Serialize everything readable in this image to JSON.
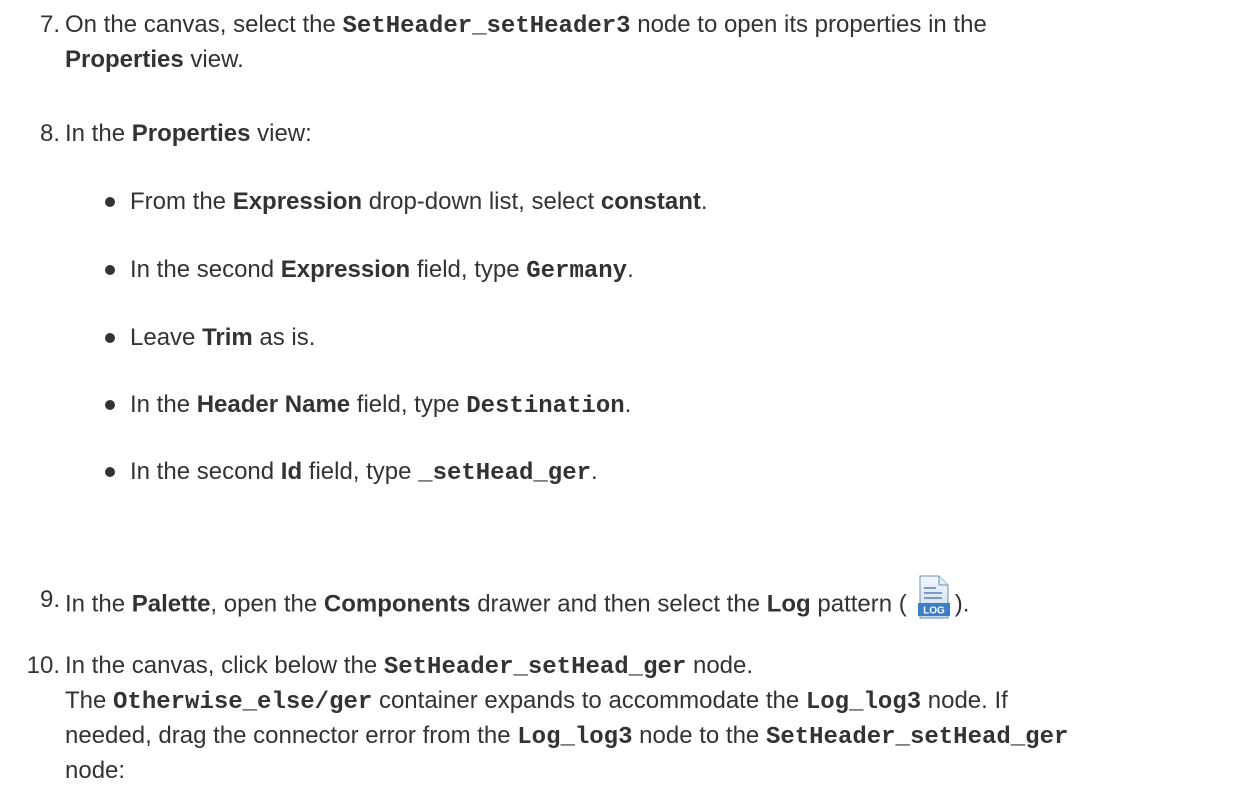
{
  "steps": [
    {
      "number": "7.",
      "t1": "On the canvas, select the ",
      "c1": "SetHeader_setHeader3",
      "t2": " node to open its properties in the ",
      "b1": "Properties",
      "t3": " view."
    },
    {
      "number": "8.",
      "t1": "In the ",
      "b1": "Properties",
      "t2": " view:"
    },
    {
      "number": "9.",
      "t1": "In the ",
      "b1": "Palette",
      "t2": ", open the ",
      "b2": "Components",
      "t3": " drawer and then select the ",
      "b3": "Log",
      "t4": " pattern (",
      "t5": ")."
    },
    {
      "number": "10.",
      "t1": "In the canvas, click below the ",
      "c1": "SetHeader_setHead_ger",
      "t2": " node.",
      "t3": "The ",
      "c2": "Otherwise_else/ger",
      "t4": " container expands to accommodate the ",
      "c3": "Log_log3",
      "t5": " node. If",
      "t6": "needed, drag the connector error from the ",
      "c4": "Log_log3",
      "t7": " node to the ",
      "c5": "SetHeader_setHead_ger",
      "t8": "node:"
    }
  ],
  "bullets": [
    {
      "t1": "From the ",
      "b1": "Expression",
      "t2": " drop-down list, select ",
      "b2": "constant",
      "t3": "."
    },
    {
      "t1": "In the second ",
      "b1": "Expression",
      "t2": " field, type ",
      "c1": "Germany",
      "t3": "."
    },
    {
      "t1": "Leave ",
      "b1": "Trim",
      "t2": " as is."
    },
    {
      "t1": "In the ",
      "b1": "Header Name",
      "t2": " field, type ",
      "c1": "Destination",
      "t3": "."
    },
    {
      "t1": "In the second ",
      "b1": "Id",
      "t2": " field, type ",
      "c1": "_setHead_ger",
      "t3": "."
    }
  ],
  "icons": {
    "log_pattern": "log-pattern-icon"
  },
  "colors": {
    "text": "#333333",
    "background": "#ffffff",
    "icon_blue": "#3a7dc9"
  }
}
